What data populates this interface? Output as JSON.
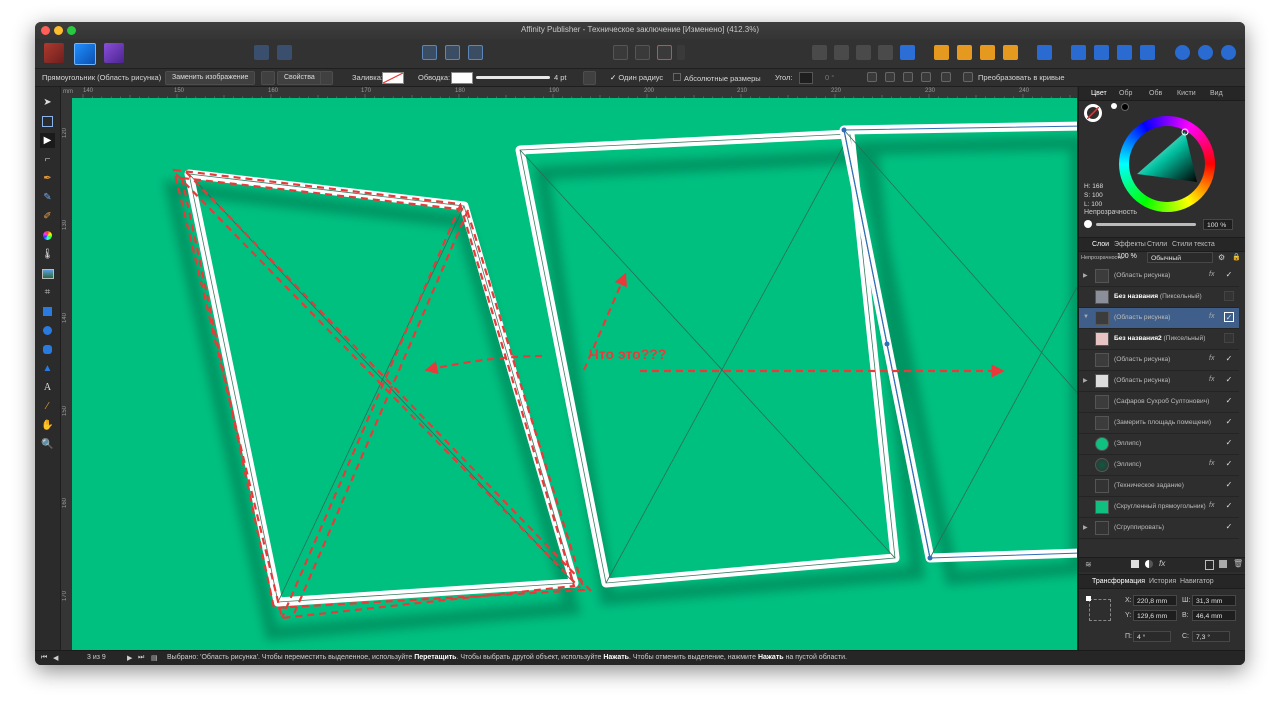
{
  "window": {
    "title": "Affinity Publisher - Техническое заключение [Изменено] (412.3%)"
  },
  "context": {
    "object_type": "Прямоугольник  (Область рисунка)",
    "replace_image": "Заменить изображение",
    "properties": "Свойства",
    "fill_label": "Заливка:",
    "stroke_label": "Обводка:",
    "stroke_width": "4 pt",
    "one_radius": "Один радиус",
    "absolute_sizes": "Абсолютные размеры",
    "angle_label": "Угол:",
    "angle_value": "0 °",
    "convert_curves": "Преобразовать в кривые"
  },
  "ruler": {
    "unit": "mm",
    "top_ticks": [
      "140",
      "150",
      "160",
      "170",
      "180",
      "190",
      "200",
      "210",
      "220",
      "230",
      "240"
    ],
    "left_ticks": [
      "120",
      "130",
      "140",
      "150",
      "160",
      "170",
      "180"
    ]
  },
  "annotation": {
    "question": "Что это???",
    "color": "#e83a3a"
  },
  "panel": {
    "color_tabs": [
      "Цвет",
      "Обр",
      "Обв",
      "Кисти",
      "Вид"
    ],
    "hsl": {
      "h": "H: 168",
      "s": "S: 100",
      "l": "L: 100"
    },
    "opacity_label": "Непрозрачность",
    "opacity_value": "100 %",
    "layer_tabs": [
      "Слои",
      "Эффекты",
      "Стили",
      "Стили текста"
    ],
    "layer_opacity_label": "Непрозрачность",
    "layer_opacity": "100 %",
    "blend_mode": "Обычный",
    "layers": [
      {
        "bold": "",
        "name": "(Область рисунка)",
        "fx": true,
        "checked": true,
        "disc": "▶"
      },
      {
        "bold": "Без названия",
        "name": " (Пиксельный)",
        "fx": false,
        "checked": false,
        "disc": ""
      },
      {
        "bold": "",
        "name": "(Область рисунка)",
        "fx": true,
        "checked": true,
        "disc": "▼",
        "selected": true
      },
      {
        "bold": "Без названия2",
        "name": " (Пиксельный)",
        "fx": false,
        "checked": false,
        "disc": ""
      },
      {
        "bold": "",
        "name": "(Область рисунка)",
        "fx": true,
        "checked": true,
        "disc": ""
      },
      {
        "bold": "",
        "name": "(Область рисунка)",
        "fx": true,
        "checked": true,
        "disc": "▶"
      },
      {
        "bold": "",
        "name": "(Сафаров Сухроб Султонович)",
        "fx": false,
        "checked": true,
        "disc": ""
      },
      {
        "bold": "",
        "name": "(Замерить площадь помещени)",
        "fx": false,
        "checked": true,
        "disc": ""
      },
      {
        "bold": "",
        "name": "(Эллипс)",
        "fx": false,
        "checked": true,
        "disc": ""
      },
      {
        "bold": "",
        "name": "(Эллипс)",
        "fx": true,
        "checked": true,
        "disc": ""
      },
      {
        "bold": "",
        "name": "(Техническое задание)",
        "fx": false,
        "checked": true,
        "disc": ""
      },
      {
        "bold": "",
        "name": "(Скругленный прямоугольник)",
        "fx": true,
        "checked": true,
        "disc": ""
      },
      {
        "bold": "",
        "name": "(Сгруппировать)",
        "fx": false,
        "checked": true,
        "disc": "▶"
      }
    ],
    "transform_tabs": [
      "Трансформация",
      "История",
      "Навигатор"
    ],
    "transform": {
      "x_label": "X:",
      "x": "220,8 mm",
      "y_label": "Y:",
      "y": "129,6 mm",
      "w_label": "Ш:",
      "w": "31,3 mm",
      "h_label": "В:",
      "h": "46,4 mm",
      "r_label": "П:",
      "r": "4 °",
      "s_label": "С:",
      "s": "7,3 °"
    }
  },
  "status": {
    "page": "3 из 9",
    "msg_prefix": "Выбрано: 'Область рисунка'. Чтобы переместить выделенное, используйте ",
    "msg_drag": "Перетащить",
    "msg_mid1": ". Чтобы выбрать другой объект, используйте ",
    "msg_click1": "Нажать",
    "msg_mid2": ". Чтобы отменить выделение, нажмите ",
    "msg_click2": "Нажать",
    "msg_suffix": " на пустой области."
  },
  "colors": {
    "canvas": "#00c080",
    "selection": "#2f6db5",
    "accent": "#2a6bd1"
  }
}
